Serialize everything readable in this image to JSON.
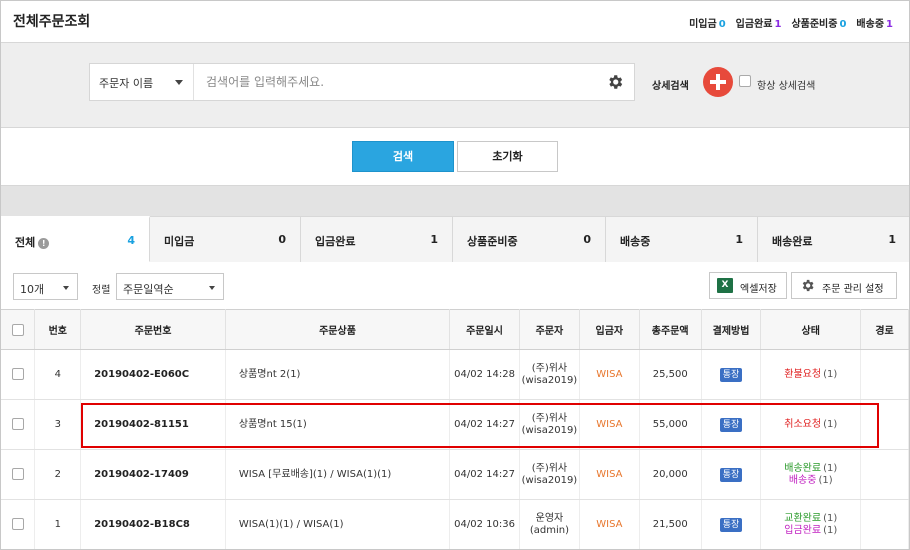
{
  "header": {
    "title": "전체주문조회",
    "summary": [
      {
        "label": "미입금",
        "count": "0"
      },
      {
        "label": "입금완료",
        "count": "1"
      },
      {
        "label": "상품준비중",
        "count": "0"
      },
      {
        "label": "배송중",
        "count": "1"
      }
    ]
  },
  "search": {
    "type_value": "주문자 이름",
    "placeholder": "검색어를 입력해주세요.",
    "detail_label": "상세검색",
    "always_detail_label": "항상 상세검색"
  },
  "buttons": {
    "search": "검색",
    "reset": "초기화"
  },
  "tabs": [
    {
      "label": "전체",
      "count": "4"
    },
    {
      "label": "미입금",
      "count": "0"
    },
    {
      "label": "입금완료",
      "count": "1"
    },
    {
      "label": "상품준비중",
      "count": "0"
    },
    {
      "label": "배송중",
      "count": "1"
    },
    {
      "label": "배송완료",
      "count": "1"
    }
  ],
  "toolbar": {
    "page_size": "10개",
    "sort_label": "정렬",
    "sort_value": "주문일역순",
    "excel_label": "엑셀저장",
    "settings_label": "주문 관리 설정"
  },
  "table": {
    "columns": [
      "번호",
      "주문번호",
      "주문상품",
      "주문일시",
      "주문자",
      "입금자",
      "총주문액",
      "결제방법",
      "상태",
      "경로"
    ],
    "rows": [
      {
        "num": "4",
        "order_no": "20190402-E060C",
        "product": "상품명nt 2(1)",
        "date": "04/02 14:28",
        "orderer": "(주)위사(wisa2019)",
        "payer": "WISA",
        "total": "25,500",
        "pay_method": "통장",
        "statuses": [
          {
            "text": "환불요청",
            "count": "(1)",
            "color": "#e02020"
          }
        ]
      },
      {
        "num": "3",
        "order_no": "20190402-81151",
        "product": "상품명nt 15(1)",
        "date": "04/02 14:27",
        "orderer": "(주)위사(wisa2019)",
        "payer": "WISA",
        "total": "55,000",
        "pay_method": "통장",
        "statuses": [
          {
            "text": "취소요청",
            "count": "(1)",
            "color": "#e02020"
          }
        ]
      },
      {
        "num": "2",
        "order_no": "20190402-17409",
        "product": "WISA [무료배송](1) / WISA(1)(1)",
        "date": "04/02 14:27",
        "orderer": "(주)위사(wisa2019)",
        "payer": "WISA",
        "total": "20,000",
        "pay_method": "통장",
        "statuses": [
          {
            "text": "배송완료",
            "count": "(1)",
            "color": "#2a9a2a"
          },
          {
            "text": "배송중",
            "count": "(1)",
            "color": "#c020c0"
          }
        ]
      },
      {
        "num": "1",
        "order_no": "20190402-B18C8",
        "product": "WISA(1)(1) / WISA(1)",
        "date": "04/02 10:36",
        "orderer": "운영자(admin)",
        "payer": "WISA",
        "total": "21,500",
        "pay_method": "통장",
        "statuses": [
          {
            "text": "교환완료",
            "count": "(1)",
            "color": "#2a9a2a"
          },
          {
            "text": "입금완료",
            "count": "(1)",
            "color": "#c020c0"
          }
        ]
      }
    ]
  },
  "colors": {
    "accent": "#2aa5e0",
    "add_button": "#e74a3b",
    "highlight": "#e00000",
    "payer": "#e8772e"
  }
}
